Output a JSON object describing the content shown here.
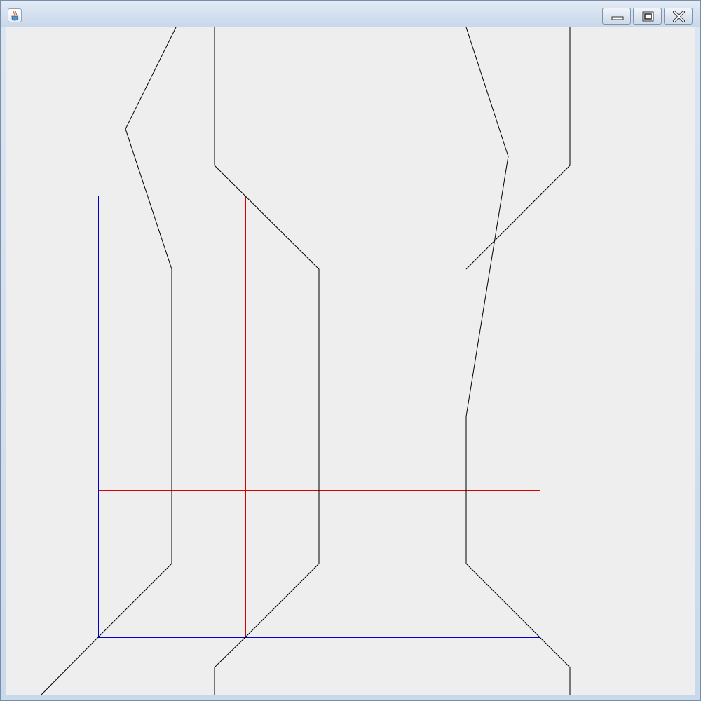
{
  "window": {
    "title": "",
    "icon": "java-coffee-cup-icon",
    "controls": {
      "minimize": "minimize-icon",
      "maximize": "maximize-icon",
      "close": "close-icon"
    }
  },
  "canvas": {
    "background": "#eeeeee",
    "grid": {
      "rows": 3,
      "columns": 3,
      "border_color": "#0000cc",
      "divider_color": "#dd0000"
    },
    "path_color": "#000000",
    "path_count": 6
  }
}
